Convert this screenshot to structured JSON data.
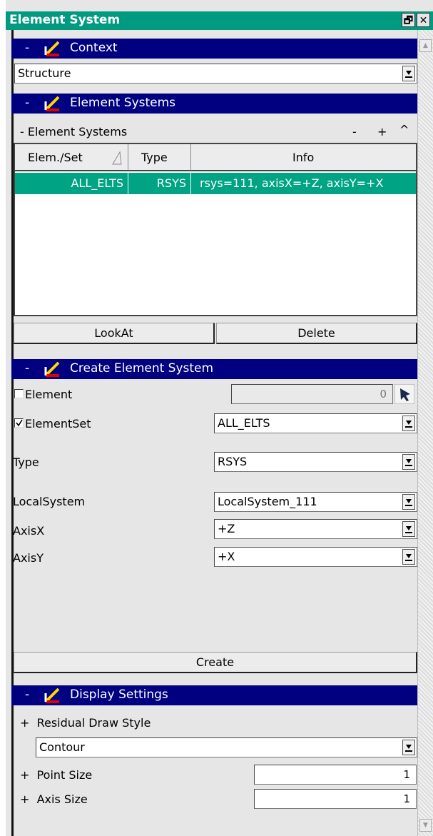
{
  "window": {
    "title": "Element System",
    "restore_glyph": "🗗",
    "close_glyph": "✕"
  },
  "context": {
    "header": "Context",
    "collapse": "-",
    "selected": "Structure"
  },
  "element_systems": {
    "header": "Element Systems",
    "collapse": "-",
    "subheader": "- Element Systems",
    "sub_actions": {
      "minus": "-",
      "plus": "+",
      "up": "^"
    },
    "columns": [
      "Elem./Set",
      "Type",
      "Info"
    ],
    "rows": [
      {
        "elem_set": "ALL_ELTS",
        "type": "RSYS",
        "info": "rsys=111, axisX=+Z, axisY=+X"
      }
    ],
    "lookat_label": "LookAt",
    "delete_label": "Delete"
  },
  "create": {
    "header": "Create Element System",
    "collapse": "-",
    "element_label": "Element",
    "element_checked": false,
    "element_value": "0",
    "elementset_label": "ElementSet",
    "elementset_checked": true,
    "elementset_value": "ALL_ELTS",
    "type_label": "Type",
    "type_value": "RSYS",
    "localsystem_label": "LocalSystem",
    "localsystem_value": "LocalSystem_111",
    "axisx_label": "AxisX",
    "axisx_value": "+Z",
    "axisy_label": "AxisY",
    "axisy_value": "+X",
    "create_label": "Create"
  },
  "display": {
    "header": "Display Settings",
    "collapse": "-",
    "residual_label": "+  Residual Draw Style",
    "residual_value": "Contour",
    "point_size_label": "+  Point Size",
    "point_size_value": "1",
    "axis_size_label": "+  Axis Size",
    "axis_size_value": "1"
  },
  "colors": {
    "title_bar": "#009a80",
    "section_header": "#000080",
    "selected_row": "#00a383"
  },
  "icons": [
    "axes-icon",
    "pick-arrow-icon",
    "combo-arrow-icon",
    "sort-icon"
  ]
}
